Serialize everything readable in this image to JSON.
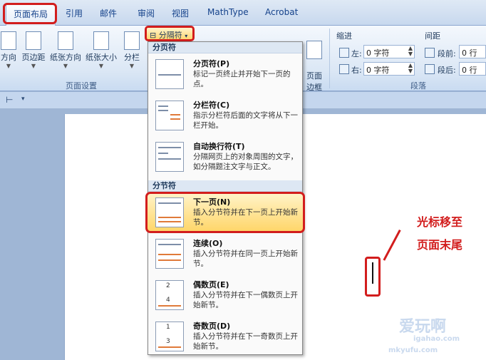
{
  "tabs": [
    "页面布局",
    "引用",
    "邮件",
    "审阅",
    "视图",
    "MathType",
    "Acrobat"
  ],
  "ribbon": {
    "buttons": [
      "方向",
      "页边距",
      "纸张方向",
      "纸张大小",
      "分栏",
      "页面\n边框"
    ],
    "group_page_setup": "页面设置",
    "indent_title": "缩进",
    "indent_left_label": "左:",
    "indent_left_value": "0 字符",
    "indent_right_label": "右:",
    "indent_right_value": "0 字符",
    "spacing_title": "间距",
    "spacing_before_label": "段前:",
    "spacing_before_value": "0 行",
    "spacing_after_label": "段后:",
    "spacing_after_value": "0 行",
    "group_paragraph": "段落"
  },
  "breaks_button": "分隔符",
  "menu": {
    "section1_title": "分页符",
    "section2_title": "分节符",
    "items": [
      {
        "title": "分页符(P)",
        "desc": "标记一页终止并开始下一页的点。"
      },
      {
        "title": "分栏符(C)",
        "desc": "指示分栏符后面的文字将从下一栏开始。"
      },
      {
        "title": "自动换行符(T)",
        "desc": "分隔网页上的对象周围的文字，如分隔题注文字与正文。"
      },
      {
        "title": "下一页(N)",
        "desc": "插入分节符并在下一页上开始新节。"
      },
      {
        "title": "连续(O)",
        "desc": "插入分节符并在同一页上开始新节。"
      },
      {
        "title": "偶数页(E)",
        "desc": "插入分节符并在下一偶数页上开始新节。"
      },
      {
        "title": "奇数页(D)",
        "desc": "插入分节符并在下一奇数页上开始新节。"
      }
    ],
    "icon_numbers": [
      "2",
      "4",
      "1",
      "3"
    ]
  },
  "annotation": {
    "line1": "光标移至",
    "line2": "页面末尾"
  },
  "watermark": {
    "main": "爱玩啊",
    "sub": "igahao.com",
    "brand": "mkyufu.com"
  },
  "colors": {
    "highlight": "#d21d1d"
  }
}
